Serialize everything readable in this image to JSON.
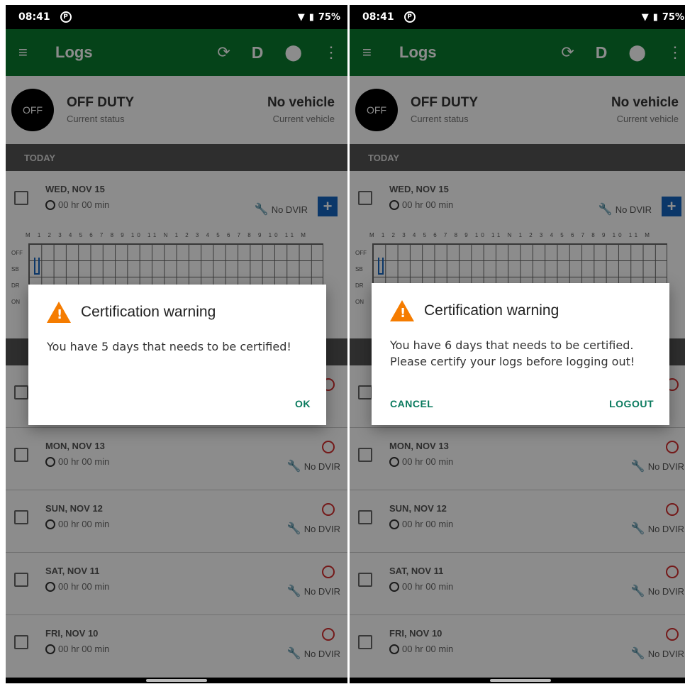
{
  "screens": [
    {
      "status_bar": {
        "time": "08:41",
        "battery": "75%"
      },
      "toolbar": {
        "title": "Logs",
        "menu_icon": "menu-icon",
        "driver_label": "D"
      },
      "duty": {
        "badge": "OFF",
        "status": "OFF DUTY",
        "status_sub": "Current status",
        "vehicle": "No vehicle",
        "vehicle_sub": "Current vehicle"
      },
      "today_label": "TODAY",
      "today_row": {
        "date": "WED, NOV 15",
        "hours": "00 hr 00 min",
        "dvir": "No DVIR"
      },
      "rows": [
        {
          "date": "MON, NOV 13",
          "hours": "00 hr 00 min",
          "dvir": "No DVIR"
        },
        {
          "date": "SUN, NOV 12",
          "hours": "00 hr 00 min",
          "dvir": "No DVIR"
        },
        {
          "date": "SAT, NOV 11",
          "hours": "00 hr 00 min",
          "dvir": "No DVIR"
        },
        {
          "date": "FRI, NOV 10",
          "hours": "00 hr 00 min",
          "dvir": "No DVIR"
        }
      ],
      "dialog": {
        "title": "Certification warning",
        "message": "You have 5 days that needs to be certified!",
        "negative": "",
        "positive": "OK"
      }
    },
    {
      "status_bar": {
        "time": "08:41",
        "battery": "75%"
      },
      "toolbar": {
        "title": "Logs",
        "menu_icon": "menu-icon",
        "driver_label": "D"
      },
      "duty": {
        "badge": "OFF",
        "status": "OFF DUTY",
        "status_sub": "Current status",
        "vehicle": "No vehicle",
        "vehicle_sub": "Current vehicle"
      },
      "today_label": "TODAY",
      "today_row": {
        "date": "WED, NOV 15",
        "hours": "00 hr 00 min",
        "dvir": "No DVIR"
      },
      "rows": [
        {
          "date": "MON, NOV 13",
          "hours": "00 hr 00 min",
          "dvir": "No DVIR"
        },
        {
          "date": "SUN, NOV 12",
          "hours": "00 hr 00 min",
          "dvir": "No DVIR"
        },
        {
          "date": "SAT, NOV 11",
          "hours": "00 hr 00 min",
          "dvir": "No DVIR"
        },
        {
          "date": "FRI, NOV 10",
          "hours": "00 hr 00 min",
          "dvir": "No DVIR"
        }
      ],
      "dialog": {
        "title": "Certification warning",
        "message": "You have 6 days that needs to be certified. Please certify your logs before logging out!",
        "negative": "CANCEL",
        "positive": "LOGOUT"
      }
    }
  ],
  "grid": {
    "hours": "M 1 2 3 4 5 6 7 8 9 10 11 N 1 2 3 4 5 6 7 8 9 10 11 M",
    "rows": [
      "OFF",
      "SB",
      "DR",
      "ON"
    ]
  },
  "colors": {
    "toolbar": "#0a7a2f",
    "accent": "#0a7a5e",
    "warning": "#f57c00",
    "add_button": "#1565c0"
  }
}
